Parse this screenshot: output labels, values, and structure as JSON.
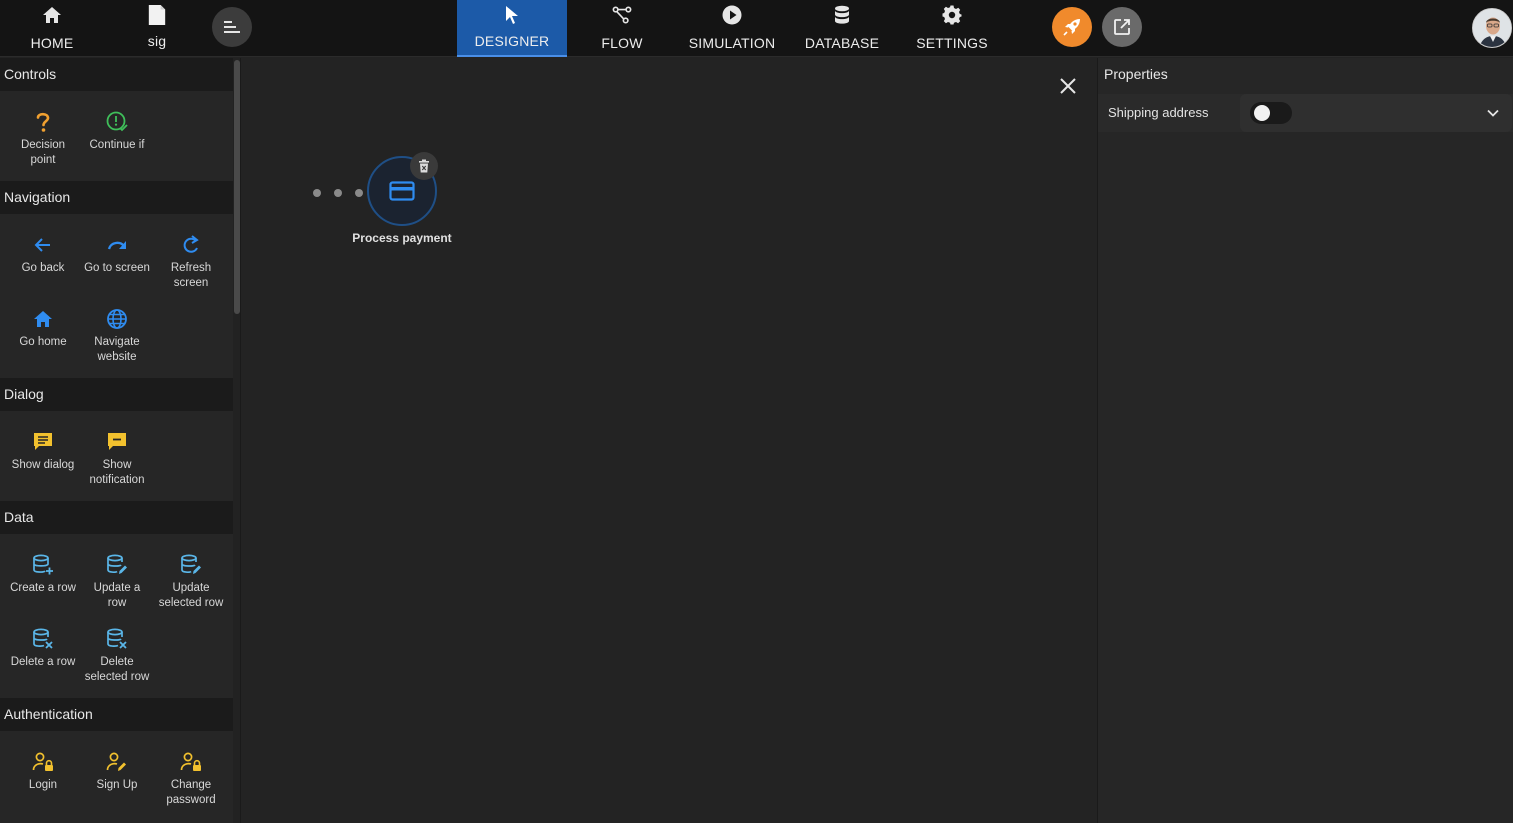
{
  "topbar": {
    "home_label": "HOME",
    "file_label": "sig",
    "tabs": [
      {
        "label": "DESIGNER",
        "icon": "cursor-icon",
        "active": true
      },
      {
        "label": "FLOW",
        "icon": "flow-icon",
        "active": false
      },
      {
        "label": "SIMULATION",
        "icon": "play-icon",
        "active": false
      },
      {
        "label": "DATABASE",
        "icon": "database-icon",
        "active": false
      },
      {
        "label": "SETTINGS",
        "icon": "gear-icon",
        "active": false
      }
    ],
    "accent_color": "#f08a2c",
    "active_tab_color": "#1c5aa8"
  },
  "toolbox": {
    "sections": [
      {
        "title": "Controls",
        "items": [
          {
            "label": "Decision point",
            "icon": "question-icon",
            "color": "#f0a030"
          },
          {
            "label": "Continue if",
            "icon": "check-circle-icon",
            "color": "#3fbf5a"
          }
        ]
      },
      {
        "title": "Navigation",
        "items": [
          {
            "label": "Go back",
            "icon": "arrow-left-icon",
            "color": "#2f8cf0"
          },
          {
            "label": "Go to screen",
            "icon": "redo-icon",
            "color": "#2f8cf0"
          },
          {
            "label": "Refresh screen",
            "icon": "refresh-icon",
            "color": "#2f8cf0"
          },
          {
            "label": "Go home",
            "icon": "home-icon",
            "color": "#2f8cf0"
          },
          {
            "label": "Navigate website",
            "icon": "globe-icon",
            "color": "#2f8cf0"
          }
        ]
      },
      {
        "title": "Dialog",
        "items": [
          {
            "label": "Show dialog",
            "icon": "message-icon",
            "color": "#f2c12e"
          },
          {
            "label": "Show notification",
            "icon": "notification-icon",
            "color": "#f2c12e"
          }
        ]
      },
      {
        "title": "Data",
        "items": [
          {
            "label": "Create a row",
            "icon": "db-add-icon",
            "color": "#5ab6e8"
          },
          {
            "label": "Update a row",
            "icon": "db-edit-icon",
            "color": "#5ab6e8"
          },
          {
            "label": "Update selected row",
            "icon": "db-edit-icon",
            "color": "#5ab6e8"
          },
          {
            "label": "Delete a row",
            "icon": "db-delete-icon",
            "color": "#5ab6e8"
          },
          {
            "label": "Delete selected row",
            "icon": "db-delete-icon",
            "color": "#5ab6e8"
          }
        ]
      },
      {
        "title": "Authentication",
        "items": [
          {
            "label": "Login",
            "icon": "user-lock-icon",
            "color": "#f2c12e"
          },
          {
            "label": "Sign Up",
            "icon": "user-edit-icon",
            "color": "#f2c12e"
          },
          {
            "label": "Change password",
            "icon": "user-lock-icon",
            "color": "#f2c12e"
          }
        ]
      }
    ]
  },
  "canvas": {
    "node_label": "Process payment",
    "node_icon": "credit-card-icon"
  },
  "properties": {
    "title": "Properties",
    "rows": [
      {
        "label": "Shipping address",
        "toggle_on": false
      }
    ]
  }
}
